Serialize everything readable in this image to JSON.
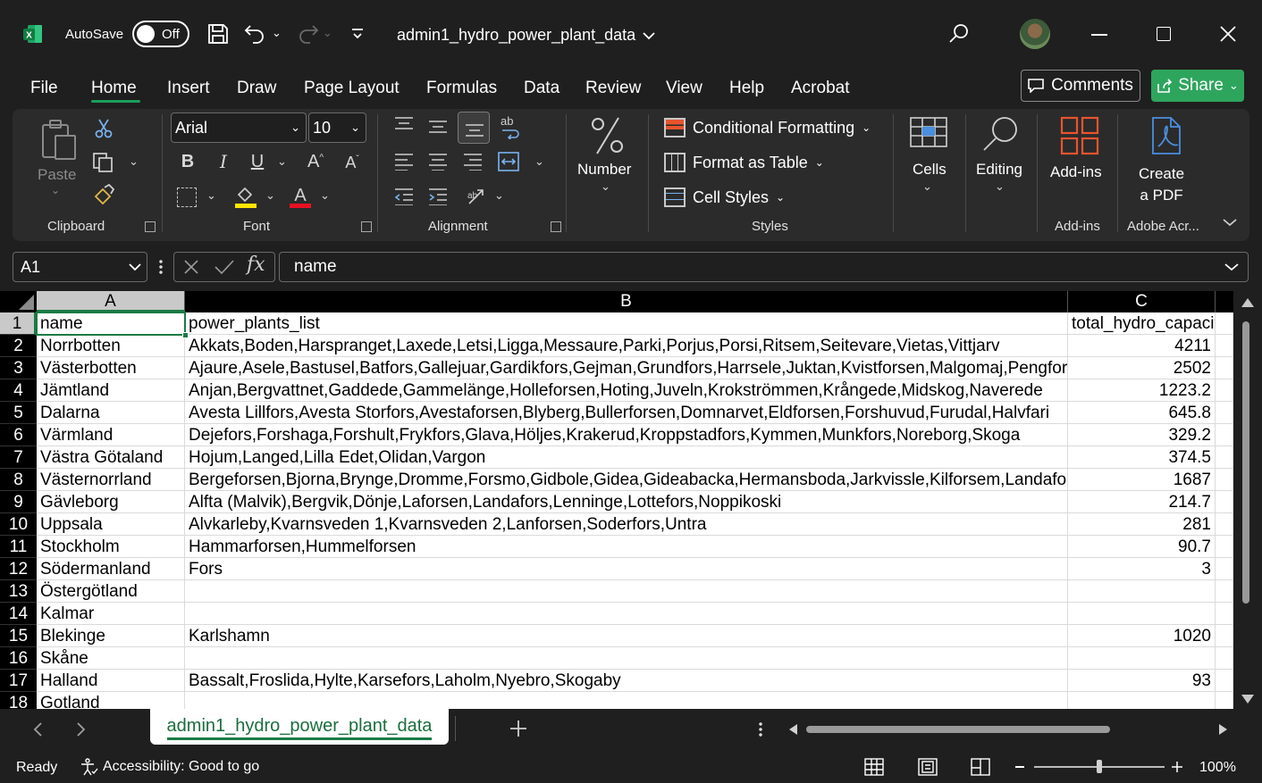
{
  "titlebar": {
    "autosave_label": "AutoSave",
    "autosave_state": "Off",
    "doc_title": "admin1_hydro_power_plant_data"
  },
  "menu": {
    "tabs": [
      "File",
      "Home",
      "Insert",
      "Draw",
      "Page Layout",
      "Formulas",
      "Data",
      "Review",
      "View",
      "Help",
      "Acrobat"
    ],
    "comments": "Comments",
    "share": "Share"
  },
  "ribbon": {
    "clipboard": {
      "paste": "Paste",
      "label": "Clipboard"
    },
    "font": {
      "family": "Arial",
      "size": "10",
      "label": "Font"
    },
    "alignment": {
      "label": "Alignment"
    },
    "number": {
      "label": "Number"
    },
    "styles": {
      "conditional": "Conditional Formatting",
      "format_table": "Format as Table",
      "cell_styles": "Cell Styles",
      "label": "Styles"
    },
    "cells": "Cells",
    "editing": "Editing",
    "addins": {
      "button": "Add-ins",
      "label": "Add-ins"
    },
    "pdf": {
      "line1": "Create",
      "line2": "a PDF",
      "label": "Adobe Acr..."
    },
    "accent_red": "#e8542f",
    "accent_blue": "#4a8fe0"
  },
  "formula_bar": {
    "name_box": "A1",
    "formula": "name"
  },
  "grid": {
    "columns": [
      "A",
      "B",
      "C"
    ],
    "row_numbers": [
      "1",
      "2",
      "3",
      "4",
      "5",
      "6",
      "7",
      "8",
      "9",
      "10",
      "11",
      "12",
      "13",
      "14",
      "15",
      "16",
      "17",
      "18"
    ],
    "rows": [
      {
        "a": "name",
        "b": "power_plants_list",
        "c": "total_hydro_capacity"
      },
      {
        "a": "Norrbotten",
        "b": "Akkats,Boden,Harspranget,Laxede,Letsi,Ligga,Messaure,Parki,Porjus,Porsi,Ritsem,Seitevare,Vietas,Vittjarv",
        "c": "4211"
      },
      {
        "a": "Västerbotten",
        "b": "Ajaure,Asele,Bastusel,Batfors,Gallejuar,Gardikfors,Gejman,Grundfors,Harrsele,Juktan,Kvistforsen,Malgomaj,Pengfors",
        "c": "2502"
      },
      {
        "a": "Jämtland",
        "b": "Anjan,Bergvattnet,Gaddede,Gammelänge,Holleforsen,Hoting,Juveln,Krokströmmen,Krångede,Midskog,Naverede",
        "c": "1223.2"
      },
      {
        "a": "Dalarna",
        "b": "Avesta Lillfors,Avesta Storfors,Avestaforsen,Blyberg,Bullerforsen,Domnarvet,Eldforsen,Forshuvud,Furudal,Halvfari",
        "c": "645.8"
      },
      {
        "a": "Värmland",
        "b": "Dejefors,Forshaga,Forshult,Frykfors,Glava,Höljes,Krakerud,Kroppstadfors,Kymmen,Munkfors,Noreborg,Skoga",
        "c": "329.2"
      },
      {
        "a": "Västra Götaland",
        "b": "Hojum,Langed,Lilla Edet,Olidan,Vargon",
        "c": "374.5"
      },
      {
        "a": "Västernorrland",
        "b": "Bergeforsen,Bjorna,Brynge,Dromme,Forsmo,Gidbole,Gidea,Gideabacka,Hermansboda,Jarkvissle,Kilforsem,Landafors",
        "c": "1687"
      },
      {
        "a": "Gävleborg",
        "b": "Alfta (Malvik),Bergvik,Dönje,Laforsen,Landafors,Lenninge,Lottefors,Noppikoski",
        "c": "214.7"
      },
      {
        "a": "Uppsala",
        "b": "Alvkarleby,Kvarnsveden 1,Kvarnsveden 2,Lanforsen,Soderfors,Untra",
        "c": "281"
      },
      {
        "a": "Stockholm",
        "b": "Hammarforsen,Hummelforsen",
        "c": "90.7"
      },
      {
        "a": "Södermanland",
        "b": "Fors",
        "c": "3"
      },
      {
        "a": "Östergötland",
        "b": "",
        "c": ""
      },
      {
        "a": "Kalmar",
        "b": "",
        "c": ""
      },
      {
        "a": "Blekinge",
        "b": "Karlshamn",
        "c": "1020"
      },
      {
        "a": "Skåne",
        "b": "",
        "c": ""
      },
      {
        "a": "Halland",
        "b": "Bassalt,Froslida,Hylte,Karsefors,Laholm,Nyebro,Skogaby",
        "c": "93"
      },
      {
        "a": "Gotland",
        "b": "",
        "c": ""
      }
    ]
  },
  "sheet_tab": "admin1_hydro_power_plant_data",
  "status": {
    "ready": "Ready",
    "accessibility": "Accessibility: Good to go",
    "zoom": "100%",
    "zoom_level": 1.0
  }
}
